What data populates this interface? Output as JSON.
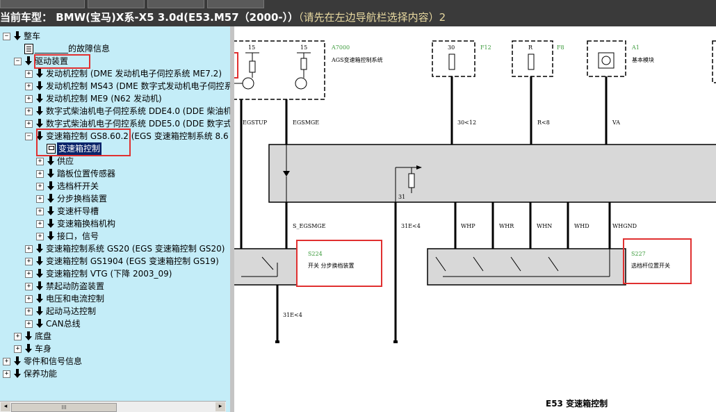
{
  "header": {
    "title": "当前车型：  BMW(宝马)X系-X5 3.0d(E53.M57（2000-））",
    "hint": "（请先在左边导航栏选择内容）2"
  },
  "tree": {
    "items": [
      {
        "label": "整车",
        "expander": "⊟"
      },
      {
        "label": "________的故障信息",
        "expander": ""
      },
      {
        "label": "驱动装置",
        "expander": "⊟"
      },
      {
        "label": "发动机控制 (DME 发动机电子伺控系统 ME7.2)",
        "expander": "⊞"
      },
      {
        "label": "发动机控制 MS43 (DME 数字式发动机电子伺控系",
        "expander": "⊞"
      },
      {
        "label": "发动机控制 ME9 (N62 发动机)",
        "expander": "⊞"
      },
      {
        "label": "数字式柴油机电子伺控系统 DDE4.0 (DDE 柴油机",
        "expander": "⊞"
      },
      {
        "label": "数字式柴油机电子伺控系统 DDE5.0 (DDE 数字式",
        "expander": "⊞"
      },
      {
        "label": "变速箱控制 GS8.60.2 (EGS 变速箱控制系统 8.6",
        "expander": "⊟"
      },
      {
        "label": "变速箱控制",
        "expander": ""
      },
      {
        "label": "供应",
        "expander": "⊞"
      },
      {
        "label": "踏板位置传感器",
        "expander": "⊞"
      },
      {
        "label": "选档杆开关",
        "expander": "⊞"
      },
      {
        "label": "分步换档装置",
        "expander": "⊞"
      },
      {
        "label": "变速杆导槽",
        "expander": "⊞"
      },
      {
        "label": "变速箱换档机构",
        "expander": "⊞"
      },
      {
        "label": "接口，信号",
        "expander": "⊞"
      },
      {
        "label": "变速箱控制系统 GS20 (EGS 变速箱控制 GS20)",
        "expander": "⊞"
      },
      {
        "label": "变速箱控制 GS1904 (EGS 变速箱控制 GS19)",
        "expander": "⊞"
      },
      {
        "label": "变速箱控制 VTG (下降 2003_09)",
        "expander": "⊞"
      },
      {
        "label": "禁起动防盗装置",
        "expander": "⊞"
      },
      {
        "label": "电压和电流控制",
        "expander": "⊞"
      },
      {
        "label": "起动马达控制",
        "expander": "⊞"
      },
      {
        "label": "CAN总线",
        "expander": "⊞"
      },
      {
        "label": "底盘",
        "expander": "⊞"
      },
      {
        "label": "车身",
        "expander": "⊞"
      },
      {
        "label": "零件和信号信息",
        "expander": "⊞"
      },
      {
        "label": "保养功能",
        "expander": "⊞"
      }
    ],
    "scroll_thumb": "III",
    "scroll_left": "◂",
    "scroll_right": "▸"
  },
  "diagram": {
    "caption": "E53 变速箱控制",
    "components": {
      "a7000_id": "A7000",
      "a7000_name": "AGS变速箱控制系统",
      "f12_id": "F12",
      "f12_pin": "30",
      "f8_id": "F8",
      "f8_pin": "R",
      "a1_id": "A1",
      "a1_name": "基本模块",
      "s224_id": "S224",
      "s224_name": "开关 分步换档装置",
      "s227_id": "S227",
      "s227_name": "选档杆位置开关",
      "pin15a": "15",
      "pin15b": "15"
    },
    "wires": {
      "egstup": "EGSTUP",
      "egsmge": "EGSMGE",
      "w30_12": "30<12",
      "wr_8": "R<8",
      "va": "VA",
      "s_egsmge": "S_EGSMGE",
      "w31e4a": "31E<4",
      "w31": "31",
      "whp": "WHP",
      "whr": "WHR",
      "whn": "WHN",
      "whd": "WHD",
      "whgnd": "WHGND",
      "w31e4b": "31E<4"
    },
    "colors": {
      "highlight": "#e03030",
      "component_label": "#3a9a3a",
      "module_fill": "#d8d8d8"
    }
  }
}
